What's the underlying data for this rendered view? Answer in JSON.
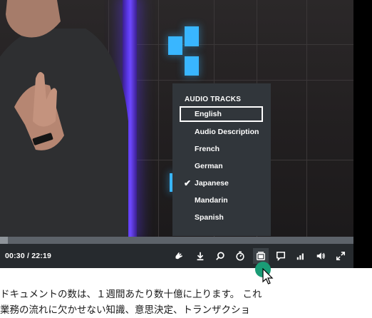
{
  "player": {
    "time": "00:30 / 22:19",
    "progress_fraction": 0.022
  },
  "audio_menu": {
    "title": "AUDIO TRACKS",
    "items": [
      {
        "label": "English",
        "focused": true,
        "selected": false
      },
      {
        "label": "Audio Description",
        "focused": false,
        "selected": false
      },
      {
        "label": "French",
        "focused": false,
        "selected": false
      },
      {
        "label": "German",
        "focused": false,
        "selected": false
      },
      {
        "label": "Japanese",
        "focused": false,
        "selected": true
      },
      {
        "label": "Mandarin",
        "focused": false,
        "selected": false
      },
      {
        "label": "Spanish",
        "focused": false,
        "selected": false
      }
    ]
  },
  "controls": [
    {
      "name": "sign-language-icon"
    },
    {
      "name": "download-icon"
    },
    {
      "name": "search-icon"
    },
    {
      "name": "playback-speed-icon"
    },
    {
      "name": "audio-tracks-icon",
      "active": true
    },
    {
      "name": "captions-icon"
    },
    {
      "name": "quality-icon"
    },
    {
      "name": "volume-icon"
    },
    {
      "name": "fullscreen-icon"
    }
  ],
  "page_text": {
    "line1": "ドキュメントの数は、１週間あたり数十億に上ります。 これ",
    "line2": "業務の流れに欠かせない知識、意思決定、トランザクショ"
  },
  "colors": {
    "menu_bg": "#31363b",
    "control_bar_bg": "#262a2e",
    "progress_track": "#5d636a",
    "cursor_highlight": "#1a9c76",
    "accent_blue": "#39b6ff",
    "accent_purple": "#5a37e8"
  }
}
